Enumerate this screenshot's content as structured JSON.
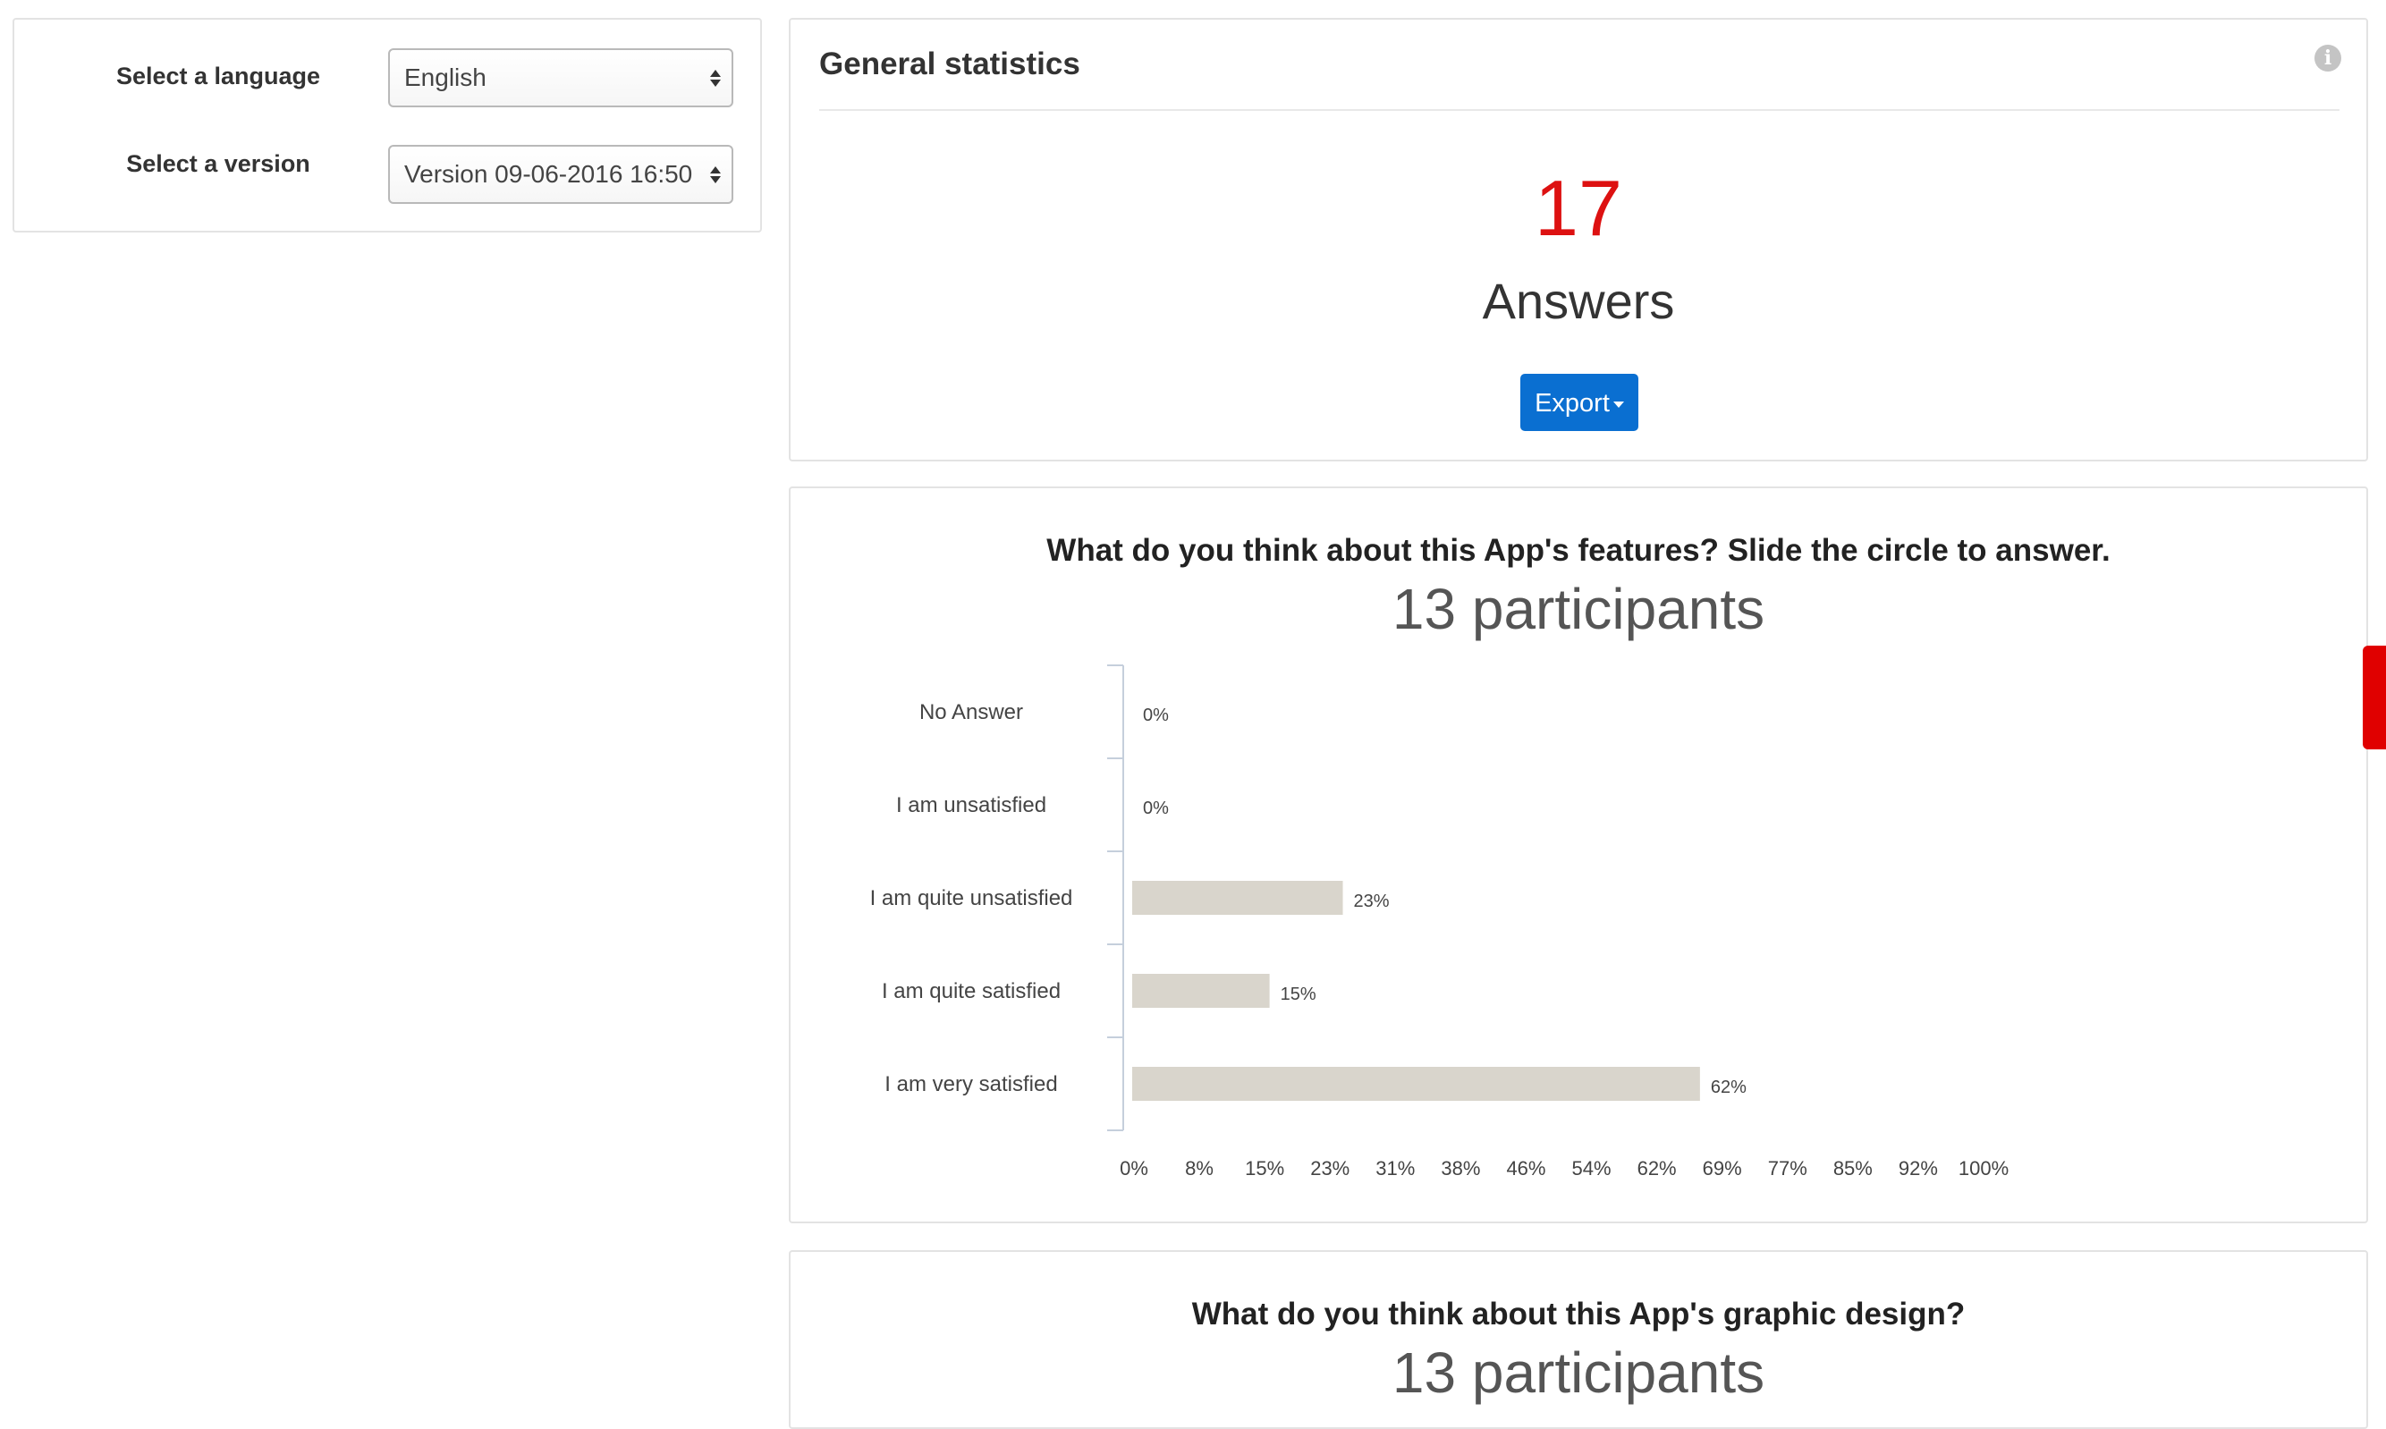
{
  "filters": {
    "language_label": "Select a language",
    "language_value": "English",
    "version_label": "Select a version",
    "version_value": "Version 09-06-2016 16:50"
  },
  "stats": {
    "title": "General statistics",
    "info_icon": "info-icon",
    "answers_count": "17",
    "answers_label": "Answers",
    "export_label": "Export"
  },
  "colors": {
    "accent_red": "#dd1111",
    "button_blue": "#0a6fd1",
    "bar_fill": "#d9d5cc",
    "side_tab": "#e00000"
  },
  "questions": [
    {
      "title": "What do you think about this App's features? Slide the circle to answer.",
      "participants": "13 participants"
    },
    {
      "title": "What do you think about this App's graphic design?",
      "participants": "13 participants"
    }
  ],
  "chart_data": {
    "type": "bar",
    "orientation": "horizontal",
    "categories": [
      "No Answer",
      "I am unsatisfied",
      "I am quite unsatisfied",
      "I am quite satisfied",
      "I am very satisfied"
    ],
    "values": [
      0,
      0,
      23,
      15,
      62
    ],
    "value_labels": [
      "0%",
      "0%",
      "23%",
      "15%",
      "62%"
    ],
    "xlim": [
      0,
      100
    ],
    "x_ticks": [
      "0%",
      "8%",
      "15%",
      "23%",
      "31%",
      "38%",
      "46%",
      "54%",
      "62%",
      "69%",
      "77%",
      "85%",
      "92%",
      "100%"
    ],
    "grid": false,
    "legend": "none"
  }
}
